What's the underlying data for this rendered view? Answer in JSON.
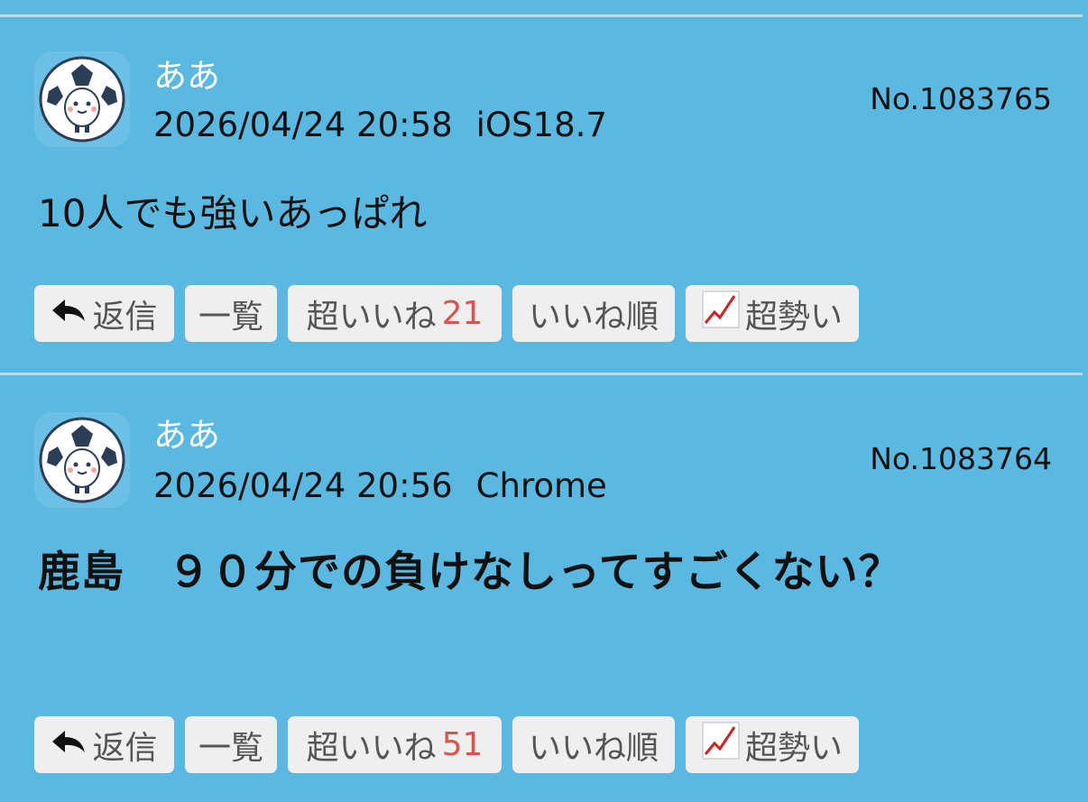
{
  "posts": [
    {
      "author": "ああ",
      "date": "2026/04/24 20:58",
      "client": "iOS18.7",
      "number": "No.1083765",
      "body": "10人でも強いあっぱれ",
      "actions": {
        "reply": "返信",
        "list": "一覧",
        "super_like": "超いいね",
        "super_like_count": "21",
        "like_order": "いいね順",
        "trending": "超勢い"
      }
    },
    {
      "author": "ああ",
      "date": "2026/04/24 20:56",
      "client": "Chrome",
      "number": "No.1083764",
      "body": "鹿島　９０分での負けなしってすごくない？",
      "actions": {
        "reply": "返信",
        "list": "一覧",
        "super_like": "超いいね",
        "super_like_count": "51",
        "like_order": "いいね順",
        "trending": "超勢い"
      }
    }
  ],
  "icons": {
    "avatar": "soccer-ball-mascot-icon",
    "reply": "reply-arrow-icon",
    "trending": "chart-increasing-icon"
  },
  "colors": {
    "background": "#5bb8e0",
    "button_bg": "#efefef",
    "count_red": "#d9534f",
    "author_white": "#ffffff"
  }
}
